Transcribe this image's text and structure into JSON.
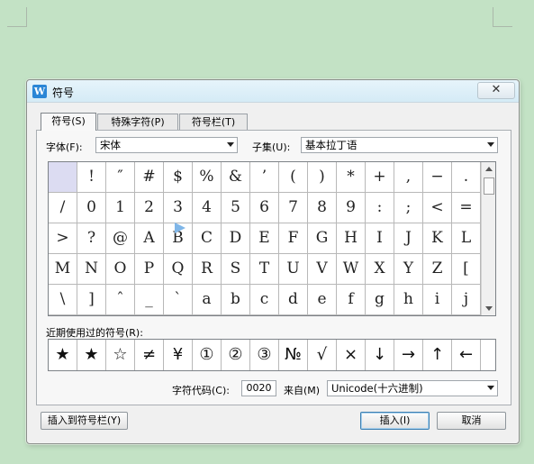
{
  "window": {
    "title": "符号",
    "close_glyph": "✕",
    "icon_letter": "W"
  },
  "tabs": [
    {
      "label": "符号(S)",
      "active": true
    },
    {
      "label": "特殊字符(P)",
      "active": false
    },
    {
      "label": "符号栏(T)",
      "active": false
    }
  ],
  "font": {
    "label": "字体(F):",
    "value": "宋体"
  },
  "subset": {
    "label": "子集(U):",
    "value": "基本拉丁语"
  },
  "symbol_grid": [
    [
      " ",
      "!",
      "″",
      "#",
      "$",
      "%",
      "&",
      "’",
      "(",
      ")",
      "*",
      "+",
      ",",
      "−",
      "."
    ],
    [
      "/",
      "0",
      "1",
      "2",
      "3",
      "4",
      "5",
      "6",
      "7",
      "8",
      "9",
      ":",
      ";",
      "<",
      "="
    ],
    [
      ">",
      "?",
      "@",
      "A",
      "B",
      "C",
      "D",
      "E",
      "F",
      "G",
      "H",
      "I",
      "J",
      "K",
      "L"
    ],
    [
      "M",
      "N",
      "O",
      "P",
      "Q",
      "R",
      "S",
      "T",
      "U",
      "V",
      "W",
      "X",
      "Y",
      "Z",
      "["
    ],
    [
      "\\",
      "]",
      "ˆ",
      "_",
      "`",
      "a",
      "b",
      "c",
      "d",
      "e",
      "f",
      "g",
      "h",
      "i",
      "j"
    ]
  ],
  "recent": {
    "label": "近期使用过的符号(R):",
    "items": [
      "★",
      "★",
      "☆",
      "≠",
      "¥",
      "①",
      "②",
      "③",
      "№",
      "√",
      "×",
      "↓",
      "→",
      "↑",
      "←"
    ]
  },
  "char_code": {
    "label": "字符代码(C):",
    "value": "0020"
  },
  "from": {
    "label": "来自(M)",
    "value": "Unicode(十六进制)"
  },
  "buttons": {
    "insert_to_bar": "插入到符号栏(Y)",
    "insert": "插入(I)",
    "cancel": "取消"
  },
  "colors": {
    "background": "#c3e2c5",
    "selected_cell": "#dcdcf2"
  }
}
